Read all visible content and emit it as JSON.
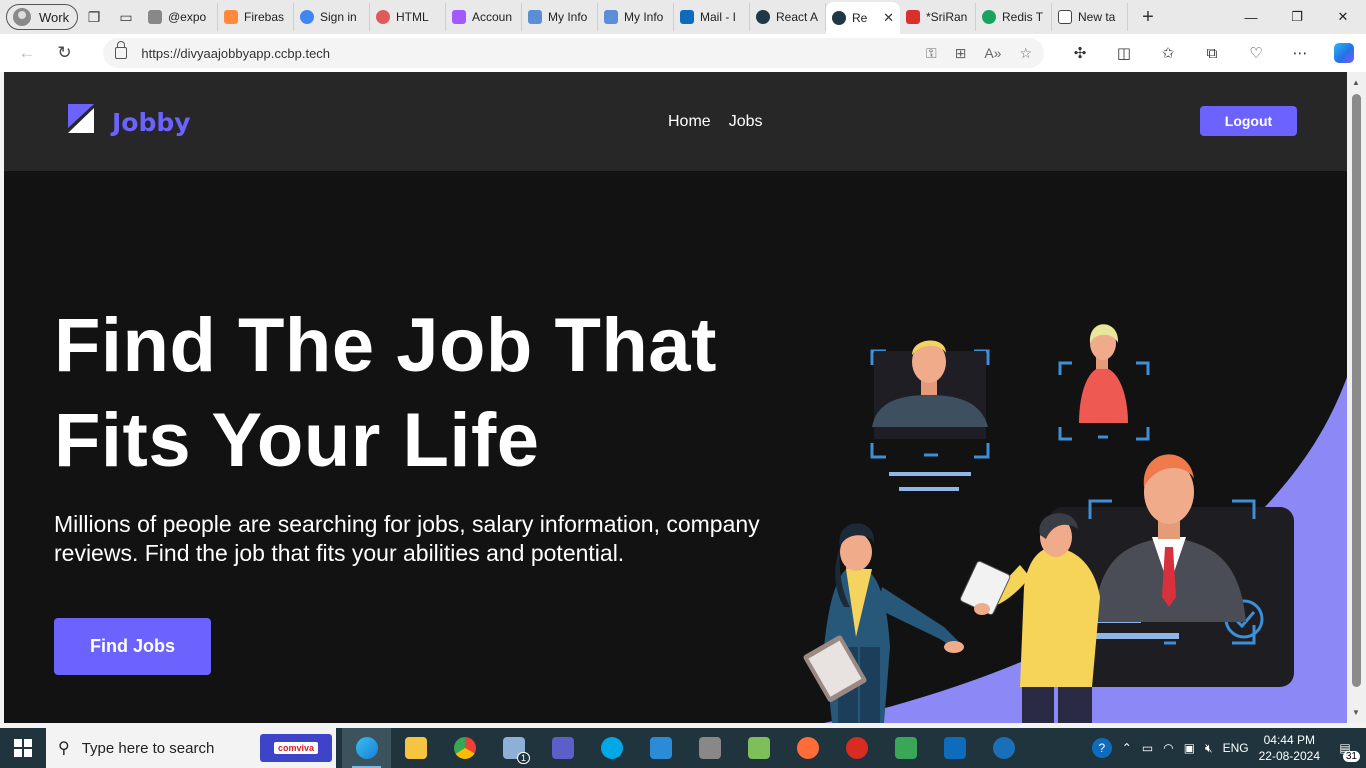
{
  "browser": {
    "profile_label": "Work",
    "tabs": [
      {
        "label": "@expo",
        "color": "#888888"
      },
      {
        "label": "Firebas",
        "color": "#ff8a3d"
      },
      {
        "label": "Sign in",
        "color": "#4285f4"
      },
      {
        "label": "HTML",
        "color": "#e15a5a"
      },
      {
        "label": "Accoun",
        "color": "#a259ff"
      },
      {
        "label": "My Info",
        "color": "#5b8ed6"
      },
      {
        "label": "My Info",
        "color": "#5b8ed6"
      },
      {
        "label": "Mail - I",
        "color": "#0f6cbd"
      },
      {
        "label": "React A",
        "color": "#203745"
      },
      {
        "label": "Re",
        "color": "#203745",
        "active": true
      },
      {
        "label": "*SriRan",
        "color": "#d9302b"
      },
      {
        "label": "Redis T",
        "color": "#1aa260"
      },
      {
        "label": "New ta",
        "color": "#444444"
      }
    ],
    "url": "https://divyaajobbyapp.ccbp.tech"
  },
  "site": {
    "brand": "Jobby",
    "nav": [
      "Home",
      "Jobs"
    ],
    "logout_label": "Logout",
    "accent_color": "#6c63ff",
    "hero": {
      "title_line1": "Find The Job That",
      "title_line2": "Fits Your Life",
      "description": "Millions of people are searching for jobs, salary information, company reviews. Find the job that fits your abilities and potential.",
      "cta_label": "Find Jobs"
    }
  },
  "taskbar": {
    "search_placeholder": "Type here to search",
    "search_promo": "comviva",
    "language": "ENG",
    "time": "04:44 PM",
    "date": "22-08-2024",
    "notification_count": "31",
    "teams_badge": "1"
  }
}
